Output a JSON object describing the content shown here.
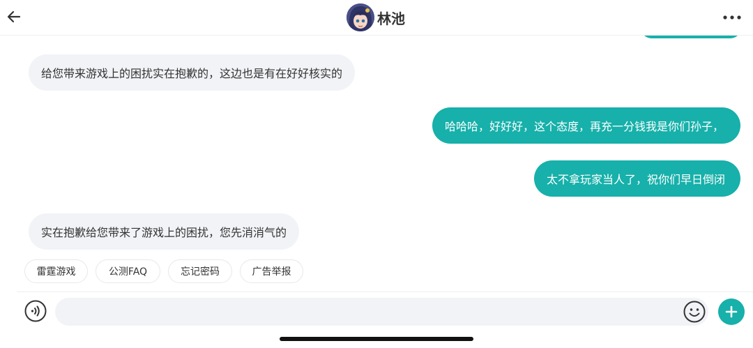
{
  "header": {
    "title": "林池",
    "back_icon": "arrow-left-icon",
    "more_icon": "more-horizontal-icon"
  },
  "messages": [
    {
      "side": "in",
      "text": "给您带来游戏上的困扰实在抱歉的，这边也是有在好好核实的"
    },
    {
      "side": "out",
      "text": "哈哈哈，好好好，这个态度，再充一分钱我是你们孙子，"
    },
    {
      "side": "out",
      "text": "太不拿玩家当人了，祝你们早日倒闭"
    },
    {
      "side": "in",
      "text": "实在抱歉给您带来了游戏上的困扰，您先消消气的"
    }
  ],
  "quick_replies": [
    "雷霆游戏",
    "公测FAQ",
    "忘记密码",
    "广告举报"
  ],
  "composer": {
    "value": "",
    "placeholder": "",
    "voice_icon": "voice-icon",
    "emoji_icon": "emoji-icon",
    "plus_icon": "plus-icon"
  },
  "colors": {
    "accent": "#17b0aa",
    "incoming_bubble": "#f1f3f6",
    "text": "#333333"
  }
}
